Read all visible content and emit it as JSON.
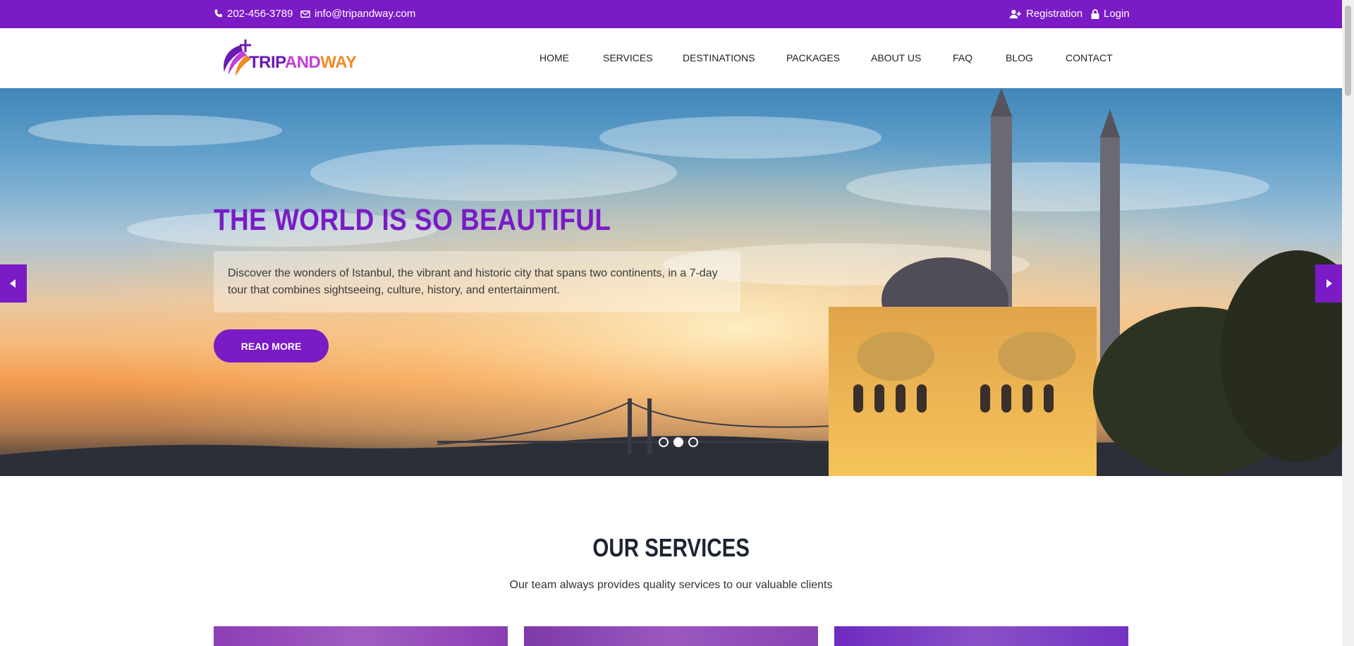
{
  "topbar": {
    "phone": "202-456-3789",
    "email": "info@tripandway.com",
    "registration": "Registration",
    "login": "Login"
  },
  "logo": {
    "part1": "TRIP",
    "part2": "AND",
    "part3": "WAY"
  },
  "nav": {
    "items": [
      "HOME",
      "SERVICES",
      "DESTINATIONS",
      "PACKAGES",
      "ABOUT US",
      "FAQ",
      "BLOG",
      "CONTACT"
    ]
  },
  "hero": {
    "title": "THE WORLD IS SO BEAUTIFUL",
    "description": "Discover the wonders of Istanbul, the vibrant and historic city that spans two continents, in a 7-day tour that combines sightseeing, culture, history, and entertainment.",
    "button": "READ MORE",
    "slides": 3,
    "active_slide": 2
  },
  "services": {
    "title": "OUR SERVICES",
    "subtitle": "Our team always provides quality services to our valuable clients"
  },
  "colors": {
    "brand": "#7a1bc6",
    "heading": "#1e2433"
  },
  "icons": [
    "phone-icon",
    "envelope-icon",
    "user-plus-icon",
    "lock-icon",
    "chevron-left-icon",
    "chevron-right-icon"
  ]
}
